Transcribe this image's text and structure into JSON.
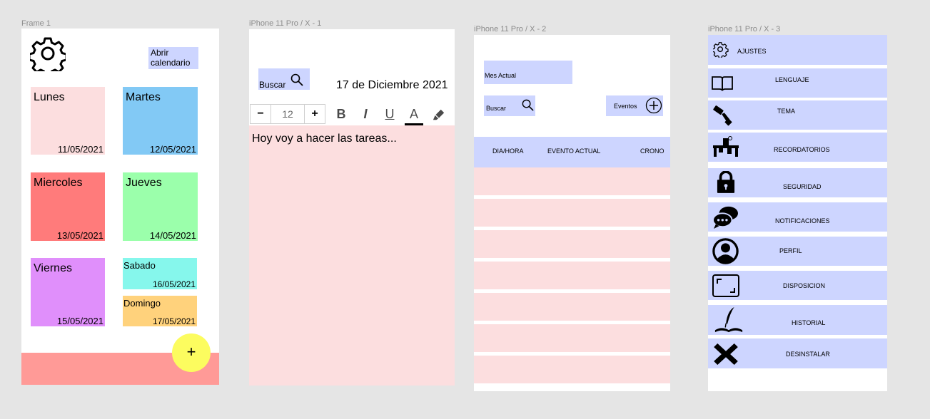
{
  "frames": {
    "f1": "Frame 1",
    "f2": "iPhone 11 Pro / X - 1",
    "f3": "iPhone 11 Pro / X - 2",
    "f4": "iPhone 11 Pro / X - 3"
  },
  "frame1": {
    "calendar_label": "Abrir calendario",
    "days": [
      {
        "name": "Lunes",
        "date": "11/05/2021",
        "color": "#fcdedf"
      },
      {
        "name": "Martes",
        "date": "12/05/2021",
        "color": "#82c9f5"
      },
      {
        "name": "Miercoles",
        "date": "13/05/2021",
        "color": "#ff7b7b"
      },
      {
        "name": "Jueves",
        "date": "14/05/2021",
        "color": "#9bffab"
      },
      {
        "name": "Viernes",
        "date": "15/05/2021",
        "color": "#e08ffb"
      },
      {
        "name": "Sabado",
        "date": "16/05/2021",
        "color": "#86f7ec"
      },
      {
        "name": "Domingo",
        "date": "17/05/2021",
        "color": "#ffd27c"
      }
    ],
    "fab_label": "+"
  },
  "frame2": {
    "search_label": "Buscar",
    "date": "17 de Diciembre 2021",
    "font_size": "12",
    "minus": "−",
    "plus": "+",
    "bold": "B",
    "italic": "I",
    "underline": "U",
    "text_color": "A",
    "editor_text": "Hoy voy a hacer las tareas..."
  },
  "frame3": {
    "month_label": "Mes Actual",
    "search_label": "Buscar",
    "events_label": "Eventos",
    "columns": [
      "DIA/HORA",
      "EVENTO ACTUAL",
      "CRONO"
    ]
  },
  "frame4": {
    "items": [
      {
        "label": "AJUSTES",
        "icon": "gear-icon"
      },
      {
        "label": "LENGUAJE",
        "icon": "book-icon"
      },
      {
        "label": "TEMA",
        "icon": "paint-roller-icon"
      },
      {
        "label": "RECORDATORIOS",
        "icon": "desk-alarm-icon"
      },
      {
        "label": "SEGURIDAD",
        "icon": "lock-icon"
      },
      {
        "label": "NOTIFICACIONES",
        "icon": "chat-bubbles-icon"
      },
      {
        "label": "PERFIL",
        "icon": "user-icon"
      },
      {
        "label": "DISPOSICION",
        "icon": "frame-icon"
      },
      {
        "label": "HISTORIAL",
        "icon": "quill-book-icon"
      },
      {
        "label": "DESINSTALAR",
        "icon": "x-icon"
      }
    ]
  }
}
